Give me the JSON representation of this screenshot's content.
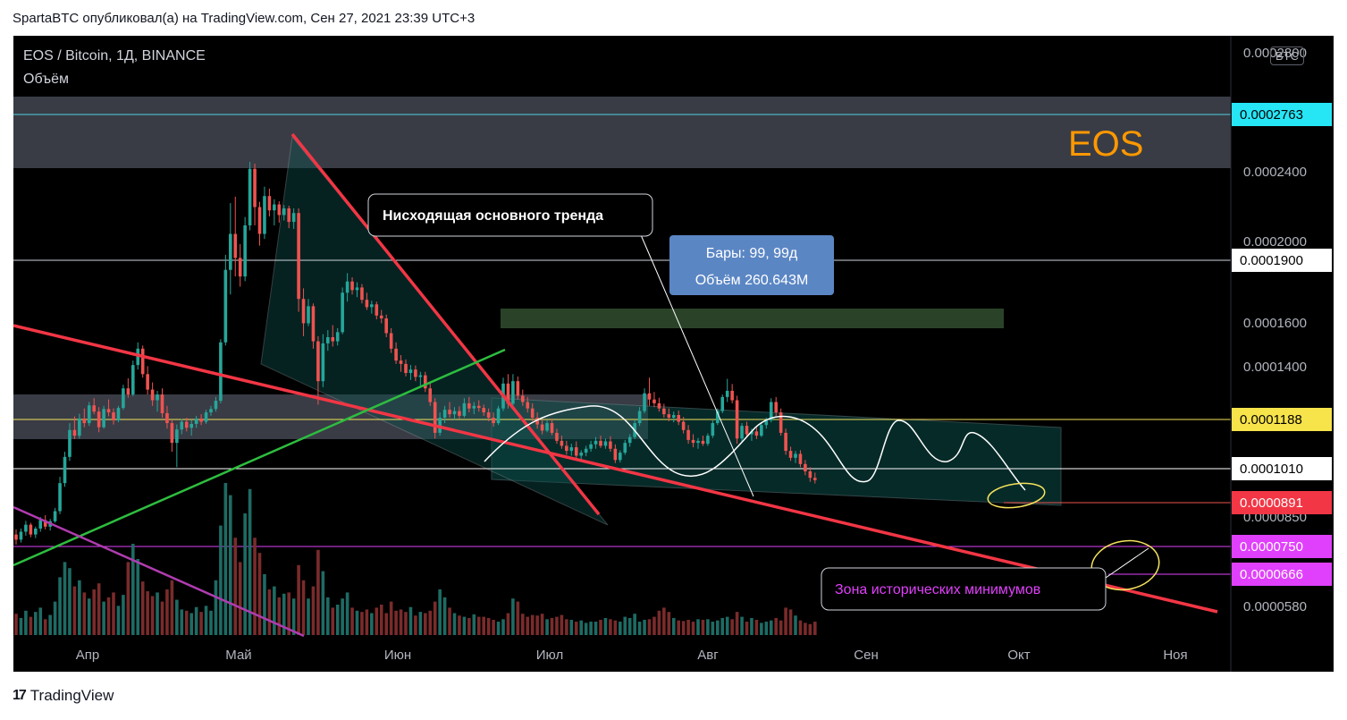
{
  "header": {
    "text": "SpartaBTC опубликовал(а) на TradingView.com, Сен 27, 2021 23:39 UTC+3"
  },
  "symbol": {
    "title": "EOS / Bitcoin, 1Д, BINANCE",
    "indicator": "Объём"
  },
  "currency_badge": "BTC",
  "footer": {
    "logo": "17",
    "brand": "TradingView"
  },
  "colors": {
    "background": "#000000",
    "up": "#26a69a",
    "down": "#ef5350",
    "axis_text": "#b2b5be",
    "trendline": "#f23645",
    "green_line": "#2ebd3f",
    "purple_line": "#b03cb0",
    "label_eos": "#ff9800"
  },
  "chart_data": {
    "type": "candlestick",
    "title": "EOS / Bitcoin, 1Д, BINANCE",
    "y_axis": {
      "scale": "log",
      "ticks": [
        "0.0002400",
        "0.0002000",
        "0.0001600",
        "0.0001400",
        "0.0000850",
        "0.0000580"
      ],
      "top_tick_partial": "0.0002800"
    },
    "x_axis": {
      "ticks": [
        "Апр",
        "Май",
        "Июн",
        "Июл",
        "Авг",
        "Сен",
        "Окт",
        "Ноя"
      ]
    },
    "ohlc": [
      [
        7.45e-05,
        7.58e-05,
        7.2e-05,
        7.32e-05
      ],
      [
        7.32e-05,
        7.6e-05,
        7.25e-05,
        7.52e-05
      ],
      [
        7.52e-05,
        7.8e-05,
        7.42e-05,
        7.7e-05
      ],
      [
        7.7e-05,
        7.75e-05,
        7.38e-05,
        7.45e-05
      ],
      [
        7.45e-05,
        7.65e-05,
        7.36e-05,
        7.6e-05
      ],
      [
        7.6e-05,
        7.9e-05,
        7.52e-05,
        7.82e-05
      ],
      [
        7.82e-05,
        7.95e-05,
        7.58e-05,
        7.65e-05
      ],
      [
        7.65e-05,
        7.85e-05,
        7.55e-05,
        7.79e-05
      ],
      [
        7.79e-05,
        8.15e-05,
        7.75e-05,
        8.06e-05
      ],
      [
        8.06e-05,
        9.05e-05,
        7.98e-05,
        8.86e-05
      ],
      [
        8.86e-05,
        9.85e-05,
        8.75e-05,
        9.68e-05
      ],
      [
        9.68e-05,
        0.0001085,
        9.55e-05,
        0.000106
      ],
      [
        0.000106,
        0.000111,
        0.0001028,
        0.000104
      ],
      [
        0.000104,
        0.000112,
        0.000103,
        0.0001102
      ],
      [
        0.0001102,
        0.000114,
        0.000107,
        0.0001085
      ],
      [
        0.0001085,
        0.0001165,
        0.0001075,
        0.0001152
      ],
      [
        0.0001152,
        0.000118,
        0.0001118,
        0.0001128
      ],
      [
        0.0001128,
        0.0001145,
        0.0001052,
        0.000107
      ],
      [
        0.000107,
        0.000115,
        0.0001065,
        0.0001138
      ],
      [
        0.0001138,
        0.0001175,
        0.000111,
        0.0001125
      ],
      [
        0.0001125,
        0.000114,
        0.000108,
        0.0001095
      ],
      [
        0.0001095,
        0.000115,
        0.0001088,
        0.0001142
      ],
      [
        0.0001142,
        0.0001235,
        0.0001135,
        0.000122
      ],
      [
        0.000122,
        0.0001262,
        0.0001182,
        0.0001195
      ],
      [
        0.0001195,
        0.000134,
        0.0001188,
        0.000132
      ],
      [
        0.000132,
        0.0001425,
        0.00013,
        0.0001395
      ],
      [
        0.0001395,
        0.000141,
        0.0001265,
        0.000128
      ],
      [
        0.000128,
        0.0001315,
        0.0001195,
        0.0001215
      ],
      [
        0.0001215,
        0.0001245,
        0.000115,
        0.0001172
      ],
      [
        0.0001172,
        0.000121,
        0.0001128,
        0.0001195
      ],
      [
        0.0001195,
        0.000122,
        0.0001105,
        0.0001122
      ],
      [
        0.0001122,
        0.000115,
        0.0001065,
        0.0001085
      ],
      [
        0.0001085,
        0.0001095,
        9.85e-05,
        0.0001015
      ],
      [
        0.0001015,
        0.000108,
        9.35e-05,
        0.0001062
      ],
      [
        0.0001062,
        0.00011,
        0.0001045,
        0.000109
      ],
      [
        0.000109,
        0.0001105,
        0.0001055,
        0.0001068
      ],
      [
        0.0001068,
        0.0001095,
        0.000104,
        0.0001082
      ],
      [
        0.0001082,
        0.0001112,
        0.0001068,
        0.0001102
      ],
      [
        0.0001102,
        0.0001118,
        0.0001078,
        0.000109
      ],
      [
        0.000109,
        0.0001135,
        0.0001082,
        0.0001125
      ],
      [
        0.0001125,
        0.000115,
        0.0001112,
        0.0001138
      ],
      [
        0.0001138,
        0.0001185,
        0.0001128,
        0.000117
      ],
      [
        0.000117,
        0.000144,
        0.000116,
        0.0001425
      ],
      [
        0.0001425,
        0.0001915,
        0.000141,
        0.000182
      ],
      [
        0.000182,
        0.000228,
        0.0001675,
        0.0002055
      ],
      [
        0.0002055,
        0.000233,
        0.000178,
        0.0001895
      ],
      [
        0.0001895,
        0.0001985,
        0.000172,
        0.000178
      ],
      [
        0.000178,
        0.0002175,
        0.0001752,
        0.0002115
      ],
      [
        0.0002115,
        0.000262,
        0.000208,
        0.000256
      ],
      [
        0.000256,
        0.0002605,
        0.0002115,
        0.000225
      ],
      [
        0.000225,
        0.000229,
        0.0001975,
        0.0002055
      ],
      [
        0.0002055,
        0.000241,
        0.000202,
        0.0002335
      ],
      [
        0.0002335,
        0.0002395,
        0.000218,
        0.0002225
      ],
      [
        0.0002225,
        0.000231,
        0.0002115,
        0.000227
      ],
      [
        0.000227,
        0.0002295,
        0.0002135,
        0.000219
      ],
      [
        0.000219,
        0.0002265,
        0.000215,
        0.000224
      ],
      [
        0.000224,
        0.000226,
        0.0002095,
        0.000214
      ],
      [
        0.000214,
        0.000224,
        0.000209,
        0.0002205
      ],
      [
        0.0002205,
        0.000224,
        0.000158,
        0.000165
      ],
      [
        0.000165,
        0.000171,
        0.0001455,
        0.000152
      ],
      [
        0.000152,
        0.000165,
        0.0001505,
        0.000161
      ],
      [
        0.000161,
        0.0001625,
        0.0001395,
        0.000143
      ],
      [
        0.000143,
        0.0001455,
        0.0001155,
        0.000125
      ],
      [
        0.000125,
        0.0001465,
        0.0001225,
        0.000142
      ],
      [
        0.000142,
        0.0001485,
        0.0001385,
        0.000145
      ],
      [
        0.000145,
        0.000151,
        0.0001405,
        0.000143
      ],
      [
        0.000143,
        0.0001495,
        0.000141,
        0.0001475
      ],
      [
        0.0001475,
        0.0001715,
        0.0001465,
        0.0001685
      ],
      [
        0.0001685,
        0.00018,
        0.0001635,
        0.000175
      ],
      [
        0.000175,
        0.0001775,
        0.0001675,
        0.00017
      ],
      [
        0.00017,
        0.0001745,
        0.000166,
        0.0001715
      ],
      [
        0.0001715,
        0.0001735,
        0.0001625,
        0.0001645
      ],
      [
        0.0001645,
        0.0001685,
        0.000159,
        0.0001605
      ],
      [
        0.0001605,
        0.000164,
        0.000157,
        0.000162
      ],
      [
        0.000162,
        0.0001635,
        0.000154,
        0.000156
      ],
      [
        0.000156,
        0.000159,
        0.000152,
        0.0001545
      ],
      [
        0.0001545,
        0.0001565,
        0.000145,
        0.000147
      ],
      [
        0.000147,
        0.0001495,
        0.0001375,
        0.0001395
      ],
      [
        0.0001395,
        0.0001425,
        0.0001325,
        0.000134
      ],
      [
        0.000134,
        0.0001365,
        0.000129,
        0.0001325
      ],
      [
        0.0001325,
        0.0001345,
        0.000127,
        0.0001285
      ],
      [
        0.0001285,
        0.000132,
        0.0001255,
        0.00013
      ],
      [
        0.00013,
        0.0001318,
        0.000125,
        0.0001268
      ],
      [
        0.0001268,
        0.000129,
        0.000123,
        0.0001275
      ],
      [
        0.0001275,
        0.000129,
        0.0001205,
        0.000122
      ],
      [
        0.000122,
        0.0001245,
        0.000115,
        0.0001165
      ],
      [
        0.0001165,
        0.000118,
        0.000103,
        0.000105
      ],
      [
        0.000105,
        0.0001125,
        0.000104,
        0.0001105
      ],
      [
        0.0001105,
        0.000115,
        0.0001085,
        0.0001135
      ],
      [
        0.0001135,
        0.0001165,
        0.0001105,
        0.0001118
      ],
      [
        0.0001118,
        0.0001145,
        0.0001098,
        0.000113
      ],
      [
        0.000113,
        0.0001148,
        0.0001102,
        0.0001112
      ],
      [
        0.0001112,
        0.000118,
        0.0001105,
        0.000116
      ],
      [
        0.000116,
        0.0001185,
        0.0001125,
        0.000114
      ],
      [
        0.000114,
        0.0001165,
        0.0001118,
        0.000115
      ],
      [
        0.000115,
        0.0001172,
        0.0001128,
        0.0001142
      ],
      [
        0.0001142,
        0.0001155,
        0.0001112,
        0.0001125
      ],
      [
        0.0001125,
        0.000114,
        0.0001092,
        0.0001105
      ],
      [
        0.0001105,
        0.0001125,
        0.0001072,
        0.0001085
      ],
      [
        0.0001085,
        0.000115,
        0.0001078,
        0.000114
      ],
      [
        0.000114,
        0.0001265,
        0.000113,
        0.000124
      ],
      [
        0.000124,
        0.000128,
        0.000114,
        0.0001158
      ],
      [
        0.0001158,
        0.000128,
        0.000115,
        0.000125
      ],
      [
        0.000125,
        0.000127,
        0.0001175,
        0.000119
      ],
      [
        0.000119,
        0.0001215,
        0.000115,
        0.0001165
      ],
      [
        0.0001165,
        0.0001185,
        0.0001125,
        0.000114
      ],
      [
        0.000114,
        0.000116,
        0.0001092,
        0.0001105
      ],
      [
        0.0001105,
        0.0001125,
        0.0001065,
        0.000108
      ],
      [
        0.000108,
        0.0001098,
        0.0001045,
        0.0001058
      ],
      [
        0.0001058,
        0.0001095,
        0.0001052,
        0.0001085
      ],
      [
        0.0001085,
        0.0001102,
        0.0001042,
        0.000105
      ],
      [
        0.000105,
        0.0001065,
        0.0001012,
        0.0001022
      ],
      [
        0.0001022,
        0.000104,
        9.95e-05,
        0.0001005
      ],
      [
        0.0001005,
        0.0001022,
        9.75e-05,
        9.88e-05
      ],
      [
        9.88e-05,
        0.0001012,
        9.72e-05,
        0.0001
      ],
      [
        0.0001,
        0.000102,
        9.65e-05,
        9.72e-05
      ],
      [
        9.72e-05,
        9.9e-05,
        9.55e-05,
        9.82e-05
      ],
      [
        9.82e-05,
        0.0001005,
        9.7e-05,
        9.95e-05
      ],
      [
        9.95e-05,
        0.0001022,
        9.85e-05,
        0.000101
      ],
      [
        0.000101,
        0.0001035,
        9.95e-05,
        0.0001022
      ],
      [
        0.0001022,
        0.000104,
        9.98e-05,
        0.0001005
      ],
      [
        0.0001005,
        0.000103,
        9.95e-05,
        0.000102
      ],
      [
        0.000102,
        0.0001038,
        9.85e-05,
        9.95e-05
      ],
      [
        9.95e-05,
        0.000101,
        9.48e-05,
        9.58e-05
      ],
      [
        9.58e-05,
        9.9e-05,
        9.5e-05,
        9.82e-05
      ],
      [
        9.82e-05,
        0.0001025,
        9.75e-05,
        0.0001015
      ],
      [
        0.0001015,
        0.0001045,
        0.0001002,
        0.0001035
      ],
      [
        0.0001035,
        0.0001095,
        0.0001028,
        0.0001085
      ],
      [
        0.0001085,
        0.0001145,
        0.0001075,
        0.000113
      ],
      [
        0.000113,
        0.000122,
        0.0001122,
        0.00012
      ],
      [
        0.00012,
        0.0001265,
        0.000115,
        0.0001175
      ],
      [
        0.0001175,
        0.0001205,
        0.0001145,
        0.000116
      ],
      [
        0.000116,
        0.0001182,
        0.0001128,
        0.000114
      ],
      [
        0.000114,
        0.0001158,
        0.0001105,
        0.0001118
      ],
      [
        0.0001118,
        0.000114,
        0.0001092,
        0.0001105
      ],
      [
        0.0001105,
        0.0001128,
        0.0001088,
        0.0001115
      ],
      [
        0.0001115,
        0.0001132,
        0.0001078,
        0.000109
      ],
      [
        0.000109,
        0.0001108,
        0.0001048,
        0.000106
      ],
      [
        0.000106,
        0.0001078,
        0.0001012,
        0.0001025
      ],
      [
        0.0001025,
        0.0001045,
        0.0001,
        0.0001015
      ],
      [
        0.0001015,
        0.0001032,
        9.95e-05,
        0.0001022
      ],
      [
        0.0001022,
        0.000104,
        0.0001005,
        0.0001012
      ],
      [
        0.0001012,
        0.0001048,
        0.0001005,
        0.000104
      ],
      [
        0.000104,
        0.0001095,
        0.0001032,
        0.0001085
      ],
      [
        0.0001085,
        0.000114,
        0.0001078,
        0.000113
      ],
      [
        0.000113,
        0.0001195,
        0.0001122,
        0.0001185
      ],
      [
        0.0001185,
        0.000126,
        0.0001165,
        0.000121
      ],
      [
        0.000121,
        0.0001238,
        0.000116,
        0.0001172
      ],
      [
        0.0001172,
        0.000119,
        0.0001012,
        0.000103
      ],
      [
        0.000103,
        0.0001085,
        0.000102,
        0.0001075
      ],
      [
        0.0001075,
        0.000109,
        0.0001035,
        0.0001045
      ],
      [
        0.0001045,
        0.0001065,
        0.0001022,
        0.0001055
      ],
      [
        0.0001055,
        0.0001075,
        0.0001028,
        0.000104
      ],
      [
        0.000104,
        0.0001085,
        0.0001035,
        0.0001078
      ],
      [
        0.0001078,
        0.0001105,
        0.0001065,
        0.0001095
      ],
      [
        0.0001095,
        0.000118,
        0.0001088,
        0.0001165
      ],
      [
        0.0001165,
        0.0001185,
        0.0001112,
        0.0001125
      ],
      [
        0.0001125,
        0.000114,
        0.000104,
        0.000105
      ],
      [
        0.000105,
        0.0001065,
        9.75e-05,
        9.88e-05
      ],
      [
        9.88e-05,
        0.0001002,
        9.55e-05,
        9.65e-05
      ],
      [
        9.65e-05,
        9.88e-05,
        9.48e-05,
        9.78e-05
      ],
      [
        9.78e-05,
        9.9e-05,
        9.35e-05,
        9.45e-05
      ],
      [
        9.45e-05,
        9.58e-05,
        9.1e-05,
        9.22e-05
      ],
      [
        9.22e-05,
        9.35e-05,
        8.9e-05,
        9.02e-05
      ],
      [
        9.02e-05,
        9.18e-05,
        8.85e-05,
        8.95e-05
      ]
    ],
    "volume": [
      35,
      28,
      40,
      30,
      38,
      45,
      26,
      33,
      55,
      95,
      120,
      110,
      80,
      90,
      70,
      60,
      75,
      85,
      55,
      62,
      70,
      48,
      66,
      120,
      150,
      125,
      88,
      72,
      64,
      70,
      55,
      75,
      90,
      58,
      42,
      40,
      36,
      46,
      38,
      48,
      40,
      90,
      180,
      250,
      230,
      160,
      120,
      200,
      240,
      160,
      135,
      100,
      75,
      80,
      62,
      68,
      70,
      60,
      115,
      90,
      60,
      80,
      140,
      105,
      62,
      45,
      50,
      60,
      70,
      45,
      40,
      38,
      42,
      36,
      45,
      50,
      36,
      55,
      40,
      42,
      38,
      46,
      32,
      38,
      36,
      40,
      55,
      75,
      62,
      45,
      36,
      32,
      30,
      28,
      34,
      30,
      30,
      28,
      25,
      22,
      26,
      36,
      60,
      55,
      35,
      30,
      33,
      32,
      35,
      26,
      28,
      30,
      33,
      26,
      25,
      22,
      24,
      20,
      22,
      22,
      25,
      28,
      26,
      24,
      22,
      30,
      28,
      35,
      22,
      25,
      26,
      30,
      40,
      45,
      38,
      28,
      24,
      23,
      25,
      22,
      26,
      25,
      26,
      22,
      24,
      28,
      30,
      26,
      38,
      30,
      22,
      28,
      25,
      20,
      22,
      24,
      28,
      24,
      45,
      42,
      32,
      24,
      20,
      18,
      22,
      17,
      16,
      15,
      12
    ]
  },
  "price_labels": {
    "cyan": "0.0002763",
    "p1900": "0.0001900",
    "yellow": "0.0001188",
    "p1010": "0.0001010",
    "current": "0.0000891",
    "p750": "0.0000750",
    "p666": "0.0000666"
  },
  "annotations": {
    "eos": "EOS",
    "downtrend": "Нисходящая основного тренда",
    "measure_bars": "Бары: 99, 99д",
    "measure_volume": "Объём 260.643M",
    "zone": "Зона исторических минимумов"
  }
}
